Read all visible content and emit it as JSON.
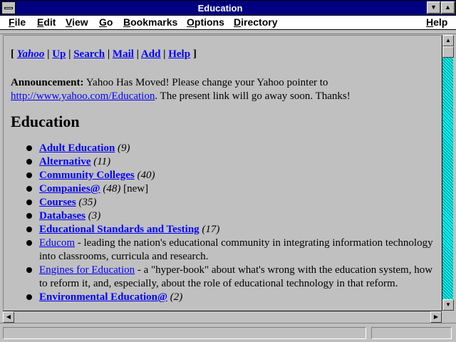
{
  "window": {
    "title": "Education"
  },
  "menubar": {
    "items": [
      "File",
      "Edit",
      "View",
      "Go",
      "Bookmarks",
      "Options",
      "Directory",
      "Help"
    ]
  },
  "nav": {
    "open_bracket": "[",
    "close_bracket": "]",
    "links": [
      "Yahoo",
      "Up",
      "Search",
      "Mail",
      "Add",
      "Help"
    ]
  },
  "announcement": {
    "label": "Announcement:",
    "text_before": "Yahoo Has Moved! Please change your Yahoo pointer to",
    "url": "http://www.yahoo.com/Education",
    "text_after": ". The present link will go away soon. Thanks!"
  },
  "heading": "Education",
  "categories": [
    {
      "name": "Adult Education",
      "count": "(9)",
      "bold": true,
      "desc": ""
    },
    {
      "name": "Alternative",
      "count": "(11)",
      "bold": true,
      "desc": ""
    },
    {
      "name": "Community Colleges",
      "count": "(40)",
      "bold": true,
      "desc": ""
    },
    {
      "name": "Companies@",
      "count": "(48)",
      "bold": true,
      "desc": "",
      "badge": "[new]"
    },
    {
      "name": "Courses",
      "count": "(35)",
      "bold": true,
      "desc": ""
    },
    {
      "name": "Databases",
      "count": "(3)",
      "bold": true,
      "desc": ""
    },
    {
      "name": "Educational Standards and Testing",
      "count": "(17)",
      "bold": true,
      "desc": ""
    },
    {
      "name": "Educom",
      "count": "",
      "bold": false,
      "desc": " - leading the nation's educational community in integrating information technology into classrooms, curricula and research."
    },
    {
      "name": "Engines for Education",
      "count": "",
      "bold": false,
      "desc": " - a \"hyper-book\" about what's wrong with the education system, how to reform it, and, especially, about the role of educational technology in that reform."
    },
    {
      "name": "Environmental Education@",
      "count": "(2)",
      "bold": true,
      "desc": ""
    }
  ],
  "colors": {
    "titlebar": "#000080",
    "link": "#0000ff",
    "background": "#c0c0c0"
  },
  "icons": {
    "minimize": "triangle-down-icon",
    "maximize": "triangle-up-icon"
  }
}
